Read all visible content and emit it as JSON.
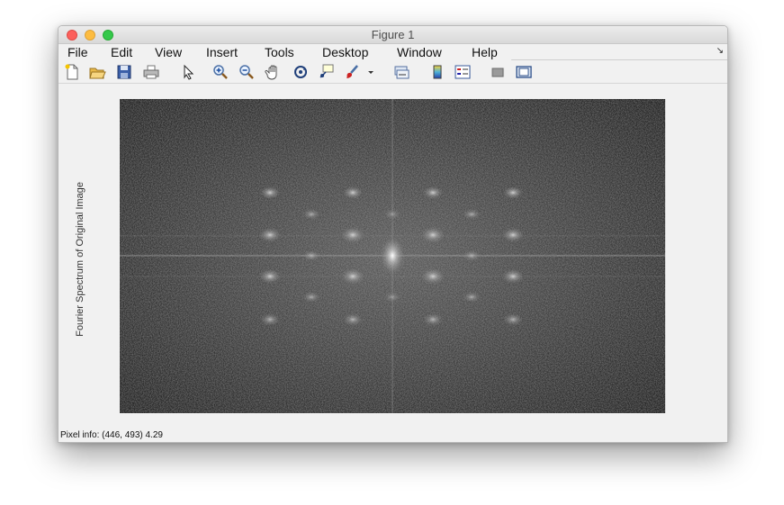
{
  "window": {
    "title": "Figure 1"
  },
  "menu": {
    "items": [
      "File",
      "Edit",
      "View",
      "Insert",
      "Tools",
      "Desktop",
      "Window",
      "Help"
    ]
  },
  "toolbar": {
    "tools": [
      {
        "name": "new-figure-icon"
      },
      {
        "name": "open-file-icon"
      },
      {
        "name": "save-icon"
      },
      {
        "name": "print-icon"
      },
      {
        "name": "pointer-icon"
      },
      {
        "name": "zoom-in-icon"
      },
      {
        "name": "zoom-out-icon"
      },
      {
        "name": "pan-hand-icon"
      },
      {
        "name": "rotate-3d-icon"
      },
      {
        "name": "data-cursor-icon"
      },
      {
        "name": "brush-icon"
      },
      {
        "name": "brush-dropdown-icon"
      },
      {
        "name": "link-plot-icon"
      },
      {
        "name": "colorbar-icon"
      },
      {
        "name": "legend-icon"
      },
      {
        "name": "hide-plot-tools-icon"
      },
      {
        "name": "show-plot-tools-icon"
      }
    ]
  },
  "axes": {
    "ylabel": "Fourier Spectrum of Original Image"
  },
  "status": {
    "pixel_info": "Pixel info: (446, 493)  4.29"
  },
  "colors": {
    "close": "#fc605c",
    "minimize": "#fdbc40",
    "maximize": "#34c84a",
    "chrome": "#f1f1f1",
    "image_bg": "#2a2a2a"
  }
}
